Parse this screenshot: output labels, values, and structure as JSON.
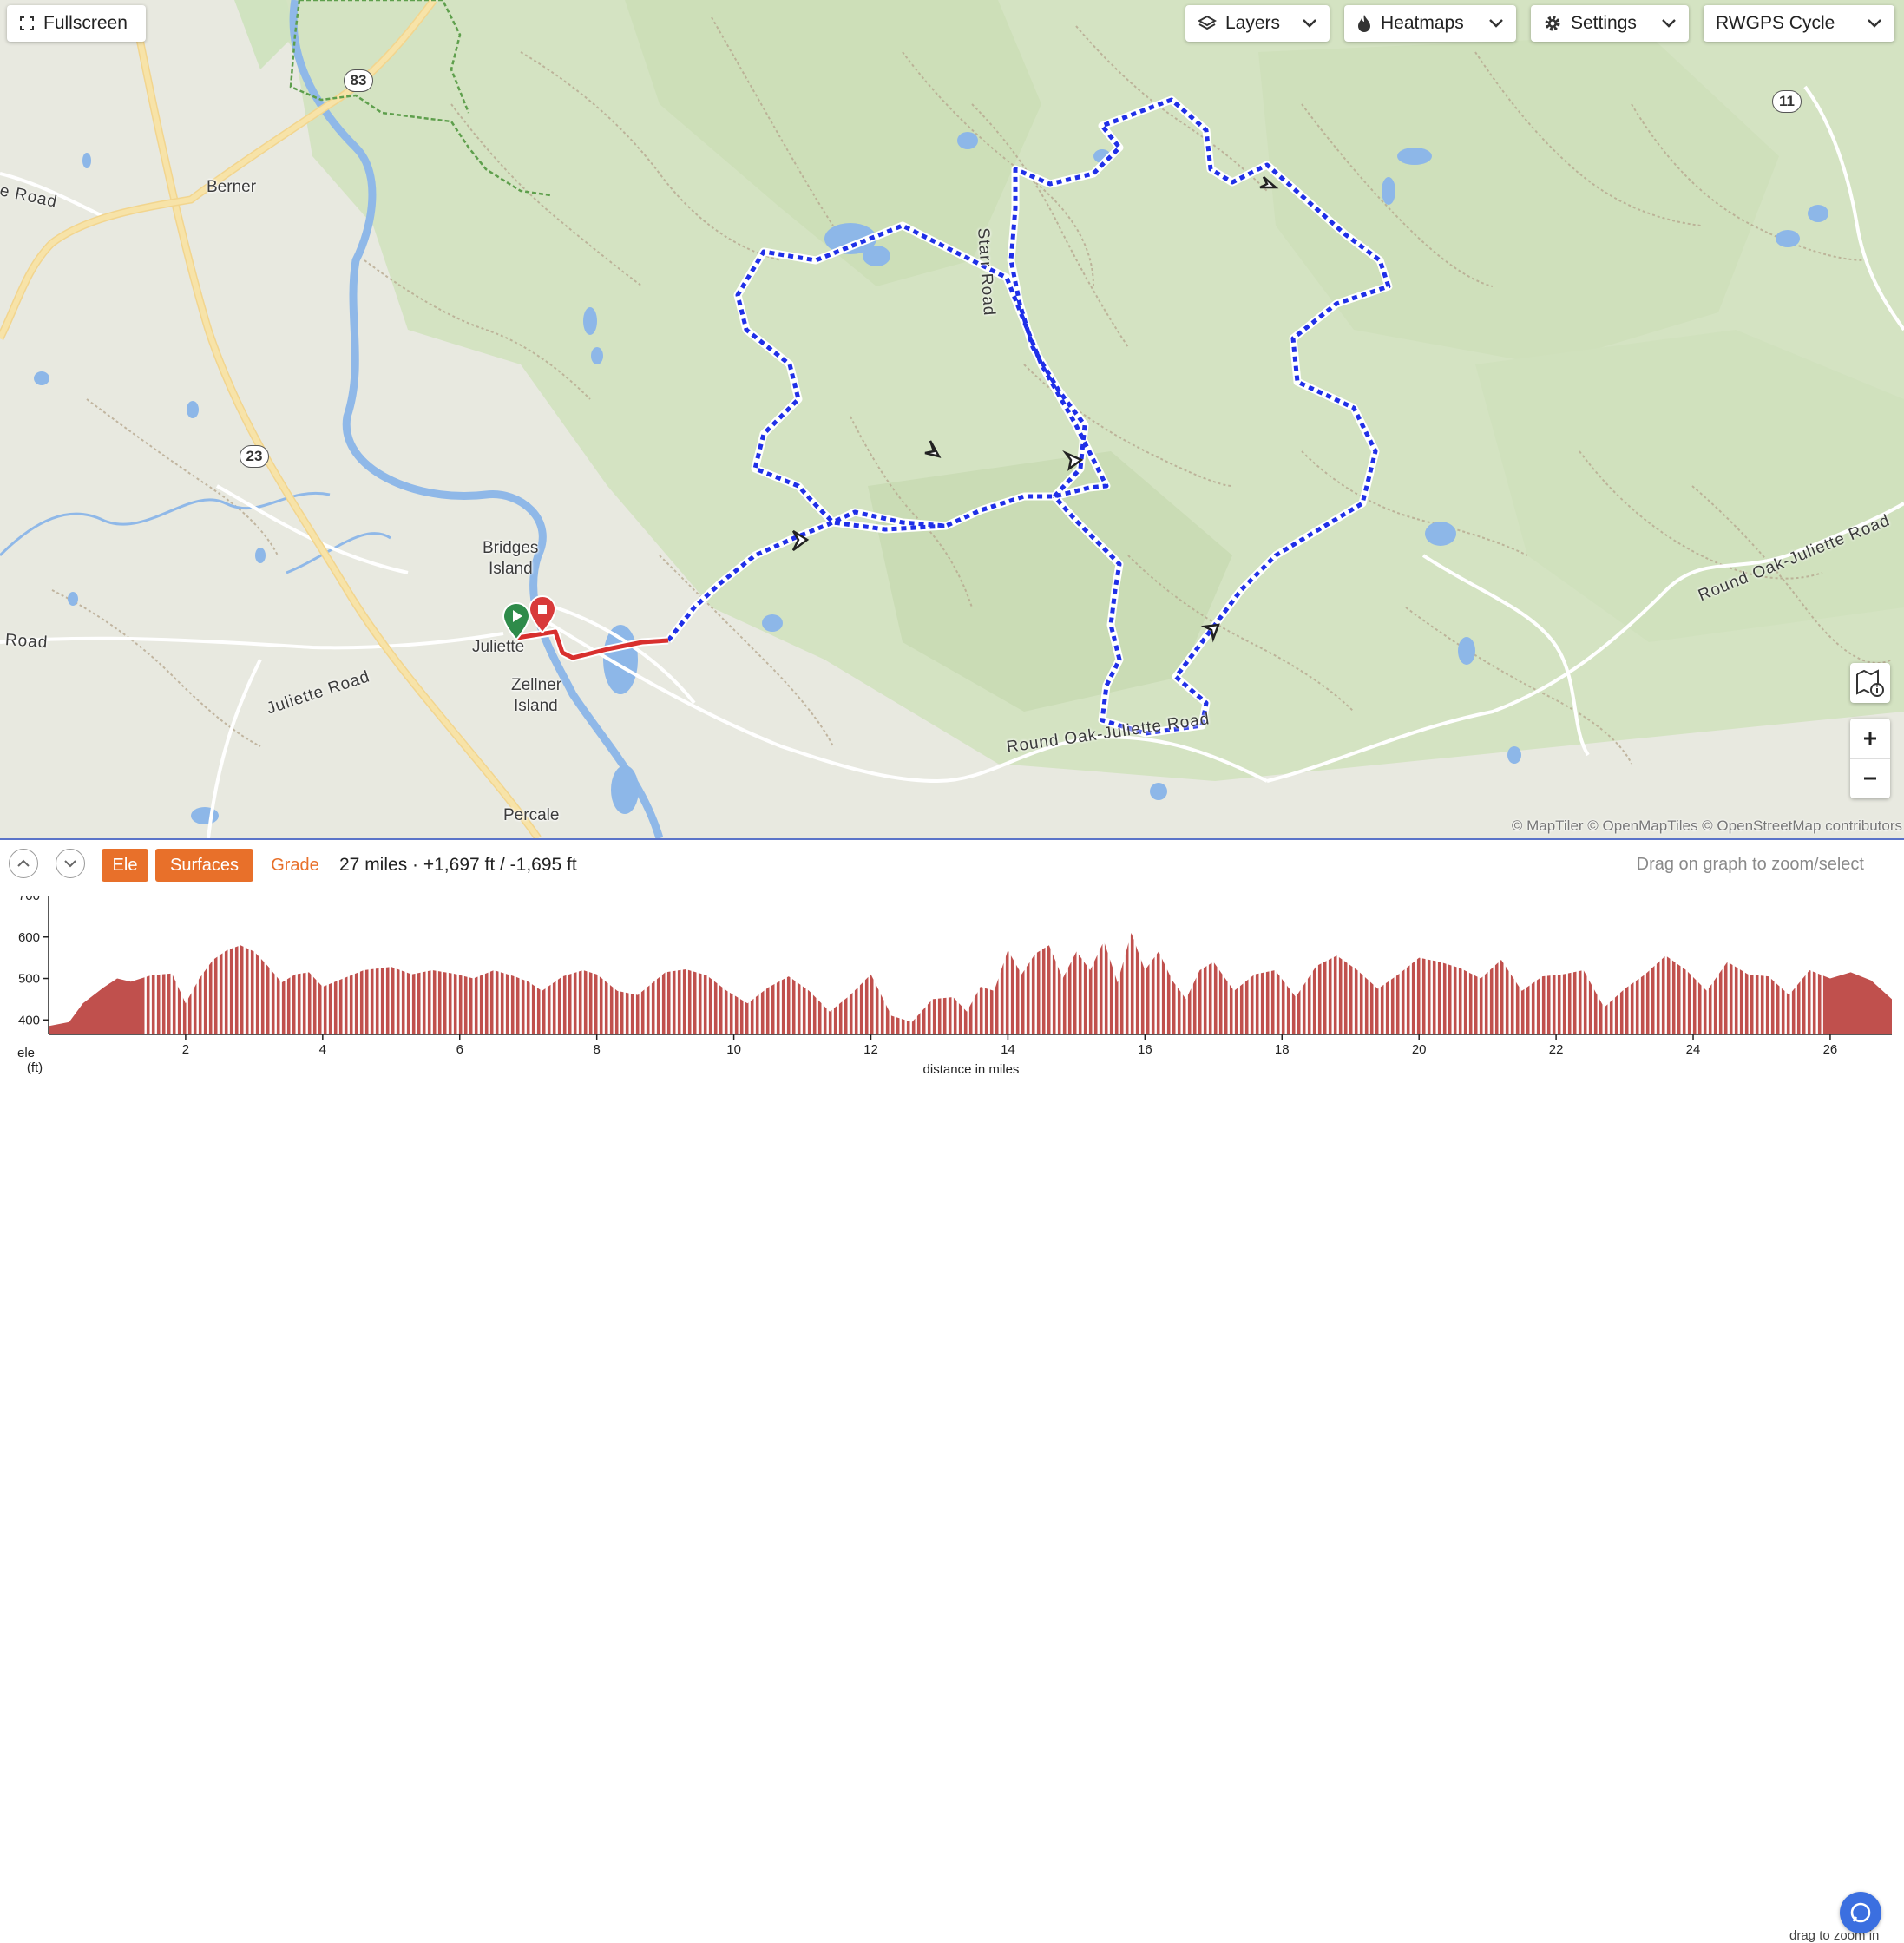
{
  "map": {
    "fullscreen_label": "Fullscreen",
    "layers_label": "Layers",
    "heatmaps_label": "Heatmaps",
    "settings_label": "Settings",
    "map_style_label": "RWGPS Cycle",
    "places": {
      "berner": "Berner",
      "bridges_island_1": "Bridges",
      "bridges_island_2": "Island",
      "juliette": "Juliette",
      "zellner_island_1": "Zellner",
      "zellner_island_2": "Island",
      "percale": "Percale"
    },
    "roads": {
      "road_left_top": "e Road",
      "road_left_mid": "Road",
      "juliette_road": "Juliette Road",
      "starr_road": "Starr Road",
      "round_oak_juliette_road_1": "Round Oak-Juliette Road",
      "round_oak_juliette_road_2": "Round Oak-Juliette Road"
    },
    "shields": {
      "r83": "83",
      "r23": "23",
      "r11": "11"
    },
    "attribution": "© MapTiler © OpenMapTiles © OpenStreetMap contributors",
    "colors": {
      "route_blue": "#1f2fe8",
      "route_red": "#d8302e",
      "start_green": "#2e8b4a",
      "end_red": "#d83a3a"
    }
  },
  "panel": {
    "ele_label": "Ele",
    "surfaces_label": "Surfaces",
    "grade_label": "Grade",
    "stats": "27 miles · +1,697 ft / -1,695 ft",
    "hint": "Drag on graph to zoom/select",
    "drag_zoom_hint": "drag to zoom in",
    "accent": "#e8702a"
  },
  "chart_data": {
    "type": "area",
    "ylabel_1": "ele",
    "ylabel_2": "(ft)",
    "xlabel": "distance in miles",
    "ylim": [
      365,
      700
    ],
    "xlim": [
      0,
      26.9
    ],
    "y_ticks": [
      400,
      500,
      600,
      700
    ],
    "x_ticks": [
      2,
      4,
      6,
      8,
      10,
      12,
      14,
      16,
      18,
      20,
      22,
      24,
      26
    ],
    "fill_color": "#c0504d",
    "x": [
      0,
      0.3,
      0.5,
      0.8,
      1.0,
      1.2,
      1.5,
      1.8,
      2.0,
      2.2,
      2.4,
      2.6,
      2.8,
      3.0,
      3.2,
      3.4,
      3.6,
      3.8,
      4.0,
      4.3,
      4.6,
      5.0,
      5.3,
      5.6,
      5.9,
      6.2,
      6.5,
      6.8,
      7.0,
      7.2,
      7.5,
      7.8,
      8.0,
      8.3,
      8.6,
      9.0,
      9.3,
      9.6,
      9.9,
      10.2,
      10.5,
      10.8,
      11.1,
      11.4,
      11.7,
      12.0,
      12.3,
      12.6,
      12.9,
      13.2,
      13.4,
      13.6,
      13.8,
      14.0,
      14.2,
      14.4,
      14.6,
      14.8,
      15.0,
      15.2,
      15.4,
      15.6,
      15.8,
      16.0,
      16.2,
      16.4,
      16.6,
      16.8,
      17.0,
      17.3,
      17.6,
      17.9,
      18.2,
      18.5,
      18.8,
      19.1,
      19.4,
      19.7,
      20.0,
      20.3,
      20.6,
      20.9,
      21.2,
      21.5,
      21.8,
      22.1,
      22.4,
      22.7,
      23.0,
      23.3,
      23.6,
      23.9,
      24.2,
      24.5,
      24.8,
      25.1,
      25.4,
      25.7,
      26.0,
      26.3,
      26.6,
      26.9
    ],
    "y": [
      385,
      395,
      440,
      478,
      500,
      492,
      508,
      512,
      440,
      500,
      545,
      568,
      580,
      565,
      530,
      490,
      510,
      515,
      480,
      500,
      520,
      528,
      510,
      520,
      512,
      500,
      520,
      505,
      492,
      470,
      505,
      520,
      510,
      470,
      460,
      515,
      522,
      508,
      470,
      440,
      478,
      505,
      470,
      420,
      460,
      510,
      410,
      395,
      450,
      455,
      420,
      480,
      470,
      568,
      510,
      560,
      580,
      500,
      565,
      520,
      590,
      490,
      610,
      520,
      565,
      495,
      450,
      520,
      540,
      470,
      510,
      520,
      455,
      530,
      555,
      520,
      475,
      510,
      550,
      540,
      525,
      500,
      545,
      470,
      505,
      510,
      520,
      430,
      475,
      510,
      555,
      520,
      470,
      540,
      510,
      505,
      460,
      520,
      500,
      515,
      495,
      450
    ]
  }
}
